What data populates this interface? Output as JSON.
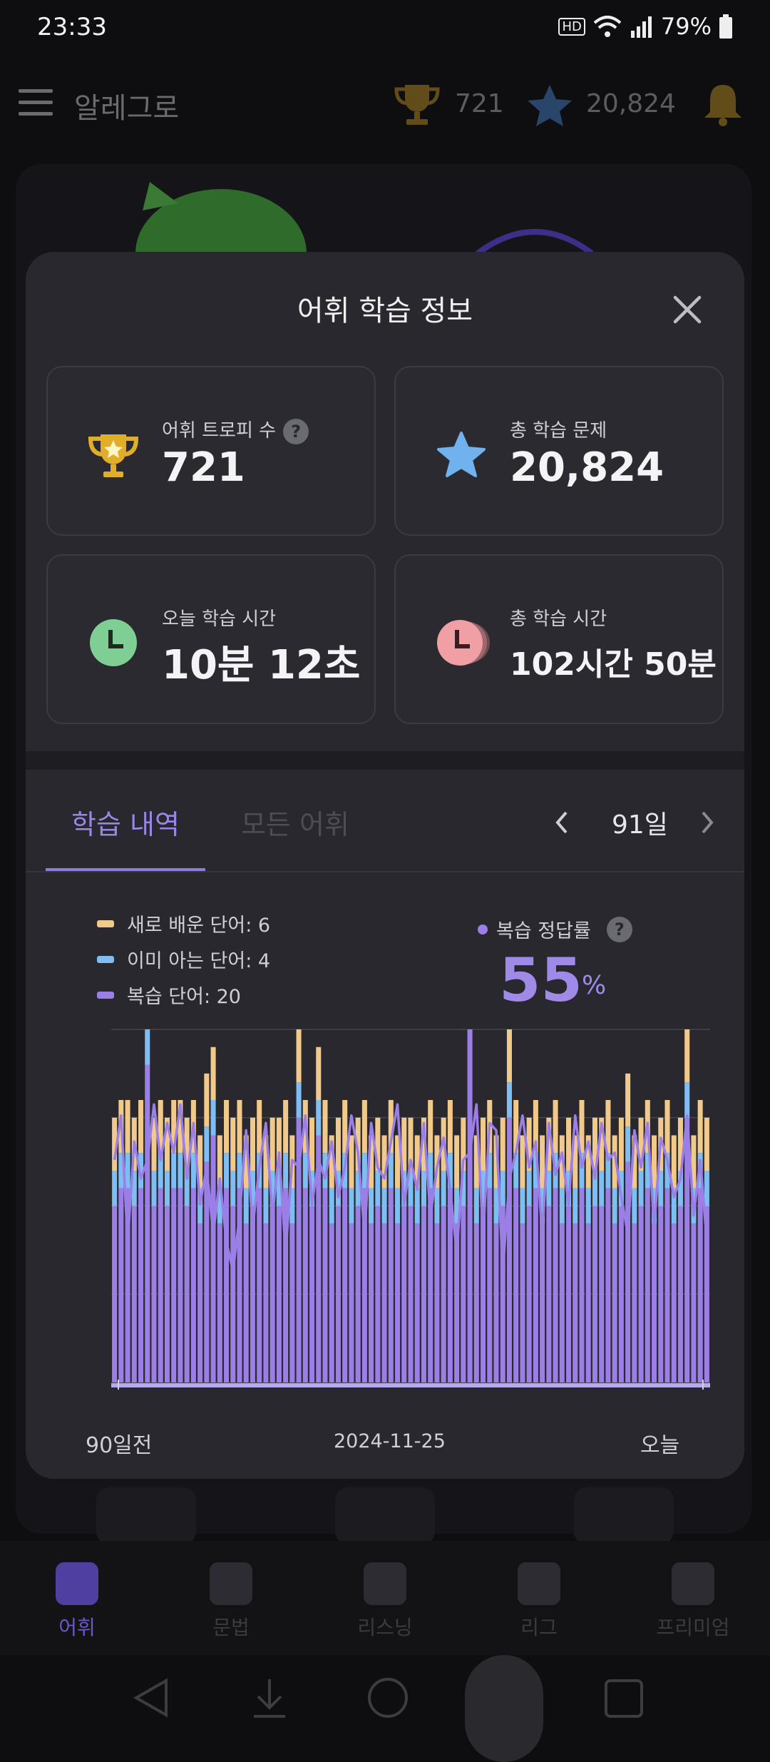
{
  "status_bar": {
    "time": "23:33",
    "battery": "79%",
    "hd_label": "HD"
  },
  "app_bar": {
    "title": "알레그로",
    "trophies": "721",
    "stars": "20,824"
  },
  "modal": {
    "title": "어휘 학습 정보",
    "stats": [
      {
        "label": "어휘 트로피 수",
        "value": "721",
        "icon": "trophy-icon",
        "help": "?"
      },
      {
        "label": "총 학습 문제",
        "value": "20,824",
        "icon": "star-icon"
      },
      {
        "label": "오늘 학습 시간",
        "value": "10분 12초",
        "icon": "clock-icon"
      },
      {
        "label": "총 학습 시간",
        "value": "102시간 50분",
        "icon": "clock-stack-icon"
      }
    ],
    "tabs": [
      {
        "label": "학습 내역"
      },
      {
        "label": "모든 어휘"
      }
    ],
    "period": "91일",
    "legend": [
      {
        "label": "새로 배운 단어: 6",
        "color": "#f1c98a"
      },
      {
        "label": "이미 아는 단어: 4",
        "color": "#7fbef2"
      },
      {
        "label": "복습 단어: 20",
        "color": "#9b7fe6"
      }
    ],
    "accuracy_label": "복습 정답률",
    "accuracy_value": "55",
    "accuracy_unit": "%",
    "x_labels": {
      "start": "90일전",
      "mid": "2024-11-25",
      "end": "오늘"
    }
  },
  "chart_data": {
    "type": "bar",
    "x_tick_labels": [
      "90일전",
      "2024-11-25",
      "오늘"
    ],
    "stacked_series": [
      {
        "name": "복습 단어",
        "color": "#9b7fe6"
      },
      {
        "name": "이미 아는 단어",
        "color": "#7fbef2"
      },
      {
        "name": "새로 배운 단어",
        "color": "#f1c98a"
      }
    ],
    "line_series": {
      "name": "복습 정답률",
      "color": "#9b7fe6"
    },
    "days": 91,
    "review": [
      20,
      22,
      22,
      20,
      22,
      36,
      20,
      22,
      20,
      22,
      22,
      20,
      22,
      18,
      25,
      28,
      18,
      22,
      20,
      22,
      18,
      20,
      22,
      18,
      20,
      20,
      22,
      18,
      30,
      22,
      20,
      28,
      22,
      18,
      20,
      22,
      18,
      20,
      22,
      18,
      20,
      18,
      22,
      18,
      20,
      20,
      18,
      20,
      22,
      18,
      20,
      22,
      18,
      20,
      40,
      18,
      20,
      22,
      18,
      20,
      30,
      22,
      18,
      20,
      22,
      18,
      20,
      22,
      18,
      20,
      18,
      22,
      18,
      20,
      20,
      22,
      18,
      20,
      25,
      18,
      20,
      22,
      18,
      20,
      22,
      18,
      20,
      30,
      18,
      22,
      20
    ],
    "known": [
      4,
      4,
      4,
      4,
      4,
      4,
      4,
      4,
      4,
      4,
      4,
      4,
      4,
      4,
      4,
      4,
      4,
      4,
      4,
      4,
      4,
      4,
      4,
      4,
      4,
      4,
      4,
      4,
      4,
      4,
      4,
      4,
      4,
      4,
      4,
      4,
      4,
      4,
      4,
      4,
      4,
      4,
      4,
      4,
      4,
      4,
      4,
      4,
      4,
      4,
      4,
      4,
      4,
      4,
      4,
      4,
      4,
      4,
      4,
      4,
      4,
      4,
      4,
      4,
      4,
      4,
      4,
      4,
      4,
      4,
      4,
      4,
      4,
      4,
      4,
      4,
      4,
      4,
      4,
      4,
      4,
      4,
      4,
      4,
      4,
      4,
      4,
      4,
      4,
      4,
      4
    ],
    "new": [
      6,
      6,
      6,
      6,
      6,
      6,
      6,
      6,
      6,
      6,
      6,
      6,
      6,
      6,
      6,
      6,
      6,
      6,
      6,
      6,
      6,
      6,
      6,
      6,
      6,
      6,
      6,
      6,
      6,
      6,
      6,
      6,
      6,
      6,
      6,
      6,
      6,
      6,
      6,
      6,
      6,
      6,
      6,
      6,
      6,
      6,
      6,
      6,
      6,
      6,
      6,
      6,
      6,
      6,
      6,
      6,
      6,
      6,
      6,
      6,
      6,
      6,
      6,
      6,
      6,
      6,
      6,
      6,
      6,
      6,
      6,
      6,
      6,
      6,
      6,
      6,
      6,
      6,
      6,
      6,
      6,
      6,
      6,
      6,
      6,
      6,
      6,
      6,
      6,
      6,
      6
    ],
    "accuracy": [
      60,
      72,
      38,
      65,
      55,
      60,
      75,
      60,
      70,
      62,
      75,
      55,
      70,
      48,
      58,
      40,
      55,
      38,
      30,
      45,
      68,
      42,
      58,
      70,
      45,
      62,
      35,
      60,
      58,
      72,
      48,
      60,
      55,
      65,
      50,
      58,
      72,
      62,
      40,
      70,
      58,
      55,
      65,
      75,
      48,
      60,
      52,
      70,
      45,
      58,
      66,
      52,
      35,
      60,
      62,
      75,
      40,
      70,
      68,
      30,
      55,
      62,
      72,
      58,
      65,
      40,
      70,
      56,
      62,
      48,
      72,
      58,
      65,
      55,
      70,
      60,
      62,
      50,
      40,
      68,
      58,
      70,
      42,
      66,
      60,
      50,
      55,
      72,
      45,
      60,
      38
    ],
    "ylim": [
      0,
      40
    ]
  },
  "nav": [
    {
      "label": "어휘",
      "active": true
    },
    {
      "label": "문법",
      "active": false
    },
    {
      "label": "리스닝",
      "active": false
    },
    {
      "label": "리그",
      "active": false
    },
    {
      "label": "프리미엄",
      "active": false
    }
  ],
  "colors": {
    "accent": "#9a86e6",
    "card_bg": "#28282e",
    "screen_bg": "#0e0e11"
  }
}
